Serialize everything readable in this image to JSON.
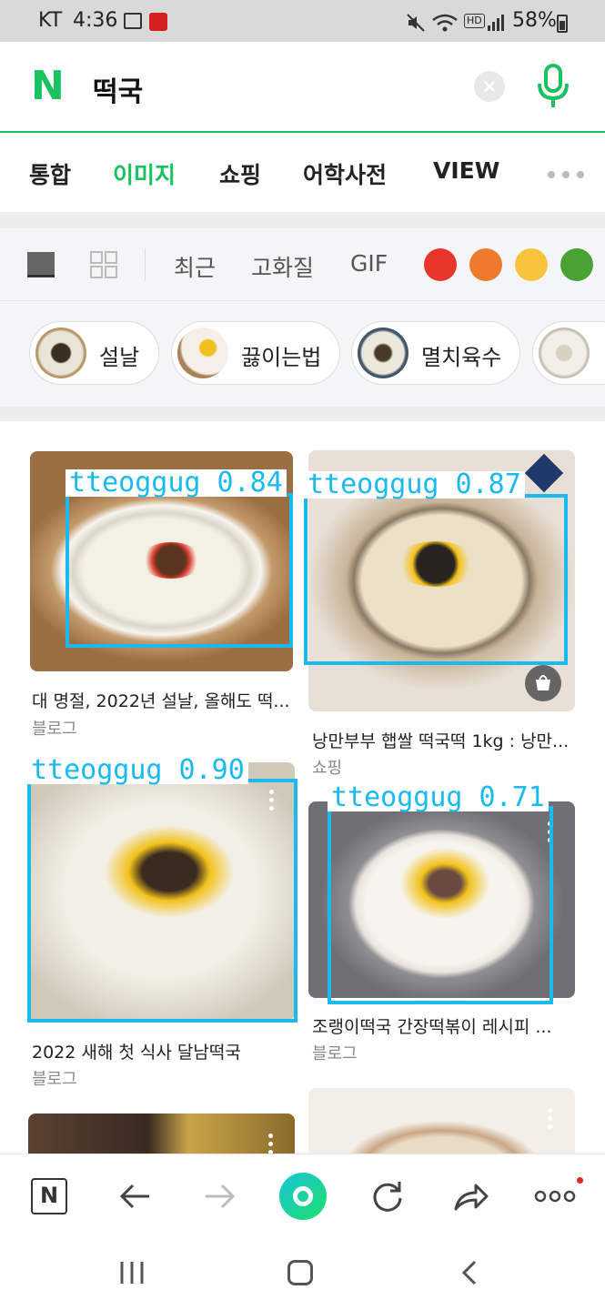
{
  "status": {
    "carrier": "KT",
    "time": "4:36",
    "battery": "58%",
    "hd_label": "HD"
  },
  "search": {
    "logo": "N",
    "query": "떡국"
  },
  "tabs": [
    {
      "label": "통합",
      "active": false
    },
    {
      "label": "이미지",
      "active": true
    },
    {
      "label": "쇼핑",
      "active": false
    },
    {
      "label": "어학사전",
      "active": false
    },
    {
      "label": "VIEW",
      "active": false
    }
  ],
  "filters": {
    "recent": "최근",
    "hq": "고화질",
    "gif": "GIF",
    "colors": [
      "#e8352a",
      "#ee7a2d",
      "#f6c33b",
      "#4aa233"
    ]
  },
  "chips": [
    {
      "label": "설날"
    },
    {
      "label": "끓이는법"
    },
    {
      "label": "멸치육수"
    }
  ],
  "results": [
    {
      "title": "대 명절, 2022년 설날, 올해도 떡...",
      "source": "블로그",
      "det": "tteoggug 0.84"
    },
    {
      "title": "낭만부부 햅쌀 떡국떡 1kg : 낭만...",
      "source": "쇼핑",
      "det": "tteoggug 0.87"
    },
    {
      "title": "2022 새해 첫 식사 달남떡국",
      "source": "블로그",
      "det": "tteoggug 0.90"
    },
    {
      "title": "조랭이떡국 간장떡볶이 레시피 ...",
      "source": "블로그",
      "det": "tteoggug 0.71"
    }
  ],
  "toolbar": {
    "home_logo": "N"
  },
  "accent": "#17c25f",
  "detection_color": "#1ab9ee"
}
